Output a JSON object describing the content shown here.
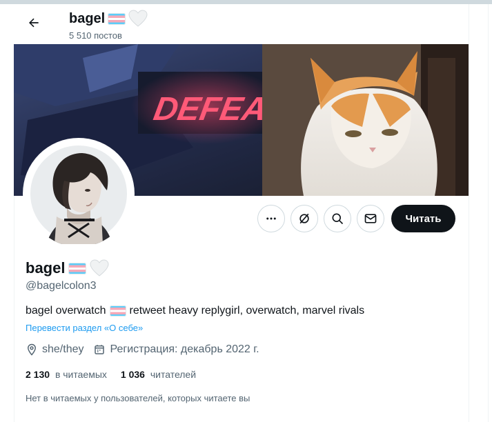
{
  "header": {
    "display_name": "bagel",
    "post_count": "5 510 постов"
  },
  "profile": {
    "display_name": "bagel",
    "handle": "@bagelcolon3",
    "bio_before": "bagel overwatch",
    "bio_after": "retweet heavy replygirl, overwatch, marvel rivals",
    "translate_link": "Перевести раздел «О себе»",
    "pronouns": "she/they",
    "joined": "Регистрация: декабрь 2022 г.",
    "following_count": "2 130",
    "following_label": "в читаемых",
    "followers_count": "1 036",
    "followers_label": "читателей",
    "followed_by_note": "Нет в читаемых у пользователей, которых читаете вы"
  },
  "banner": {
    "sign_text": "DEFEAT"
  },
  "actions": {
    "follow_label": "Читать"
  },
  "icons": [
    "back-arrow-icon",
    "more-icon",
    "grok-icon",
    "search-icon",
    "message-icon",
    "location-icon",
    "calendar-icon",
    "trans-flag-emoji",
    "white-heart-emoji"
  ],
  "colors": {
    "accent": "#1d9bf0",
    "text": "#0f1419",
    "secondary": "#536471",
    "follow_bg": "#0f1419"
  }
}
